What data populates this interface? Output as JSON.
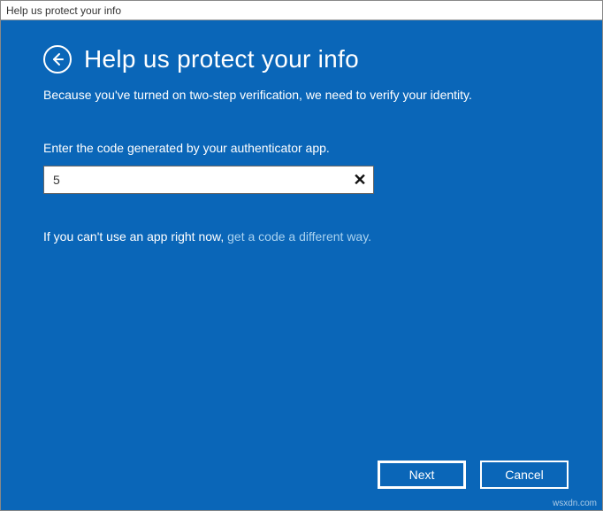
{
  "window": {
    "title": "Help us protect your info"
  },
  "header": {
    "title": "Help us protect your info",
    "subtitle": "Because you've turned on two-step verification, we need to verify your identity."
  },
  "field": {
    "label": "Enter the code generated by your authenticator app.",
    "value": "5",
    "clear_glyph": "✕"
  },
  "help": {
    "prefix": "If you can't use an app right now, ",
    "link": "get a code a different way."
  },
  "buttons": {
    "next": "Next",
    "cancel": "Cancel"
  },
  "watermark": "wsxdn.com",
  "colors": {
    "background": "#0a66b8",
    "link": "#a9d2f0"
  }
}
